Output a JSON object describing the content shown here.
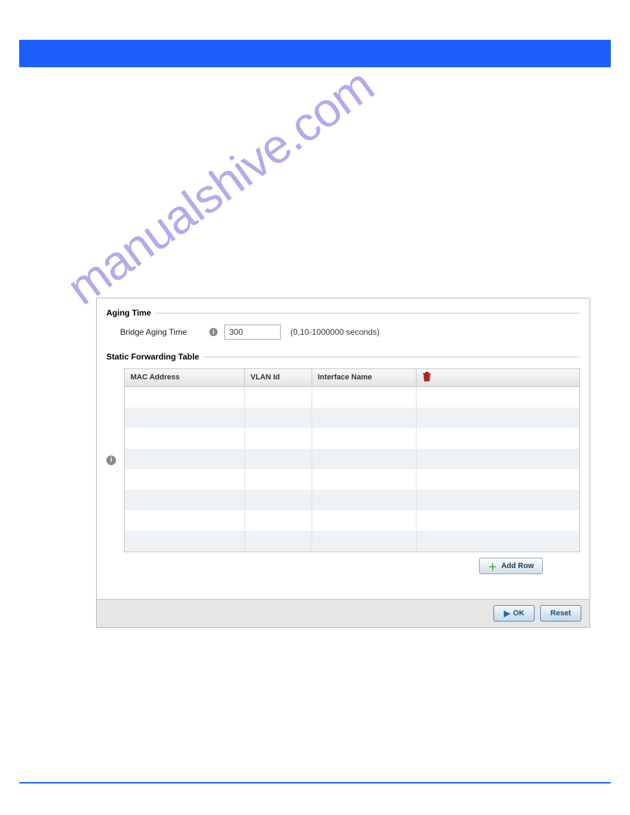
{
  "aging": {
    "legend": "Aging Time",
    "label": "Bridge Aging Time",
    "value": "300",
    "hint": "(0,10-1000000 seconds)"
  },
  "static": {
    "legend": "Static Forwarding Table",
    "headers": {
      "mac": "MAC Address",
      "vlan": "VLAN Id",
      "iface": "Interface Name"
    },
    "rows": [],
    "add_label": "Add Row"
  },
  "footer": {
    "ok": "OK",
    "reset": "Reset"
  },
  "watermark": "manualshive.com"
}
